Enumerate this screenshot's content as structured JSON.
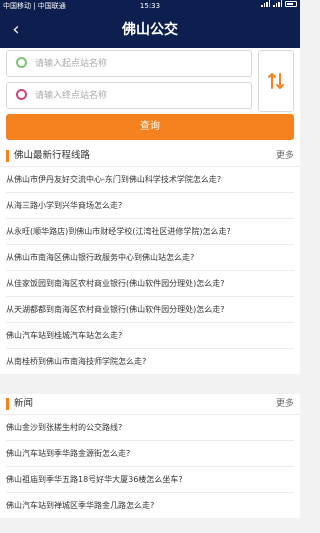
{
  "status_bar": {
    "carriers": "中国移动 | 中国联通",
    "time": "15:33"
  },
  "nav": {
    "back_symbol": "‹",
    "title": "佛山公交"
  },
  "search": {
    "start_placeholder": "请输入起点站名称",
    "end_placeholder": "请输入终点站名称",
    "query_label": "查询",
    "swap_icon": "swap-arrows-icon"
  },
  "latest_routes": {
    "heading": "佛山最新行程线路",
    "more_label": "更多",
    "items": [
      "从佛山市伊丹友好交流中心-东门到佛山科学技术学院怎么走?",
      "从海三路小学到兴华商场怎么走?",
      "从永旺(顺华路店)到佛山市财经学校(江湾社区进修学院)怎么走?",
      "从佛山市南海区佛山银行政服务中心到佛山站怎么走?",
      "从佳家饭园到南海区农村商业银行(佛山软件园分理处)怎么走?",
      "从天湖都都到南海区农村商业银行(佛山软件园分理处)怎么走?",
      "佛山汽车站到桂城汽车站怎么走?",
      "从南桂桥到佛山市南海技师学院怎么走?"
    ]
  },
  "news": {
    "heading": "新闻",
    "more_label": "更多",
    "items": [
      "佛山金沙到张槎生村的公交路线?",
      "佛山汽车站到季华路金源街怎么走?",
      "佛山祖庙到季华五路18号好华大厦36楼怎么坐车?",
      "佛山汽车站到禅城区季华路金几路怎么走?"
    ]
  },
  "colors": {
    "header": "#0d1f4e",
    "accent": "#f5821f",
    "start_dot": "#7cc576",
    "end_dot": "#c9477e"
  }
}
